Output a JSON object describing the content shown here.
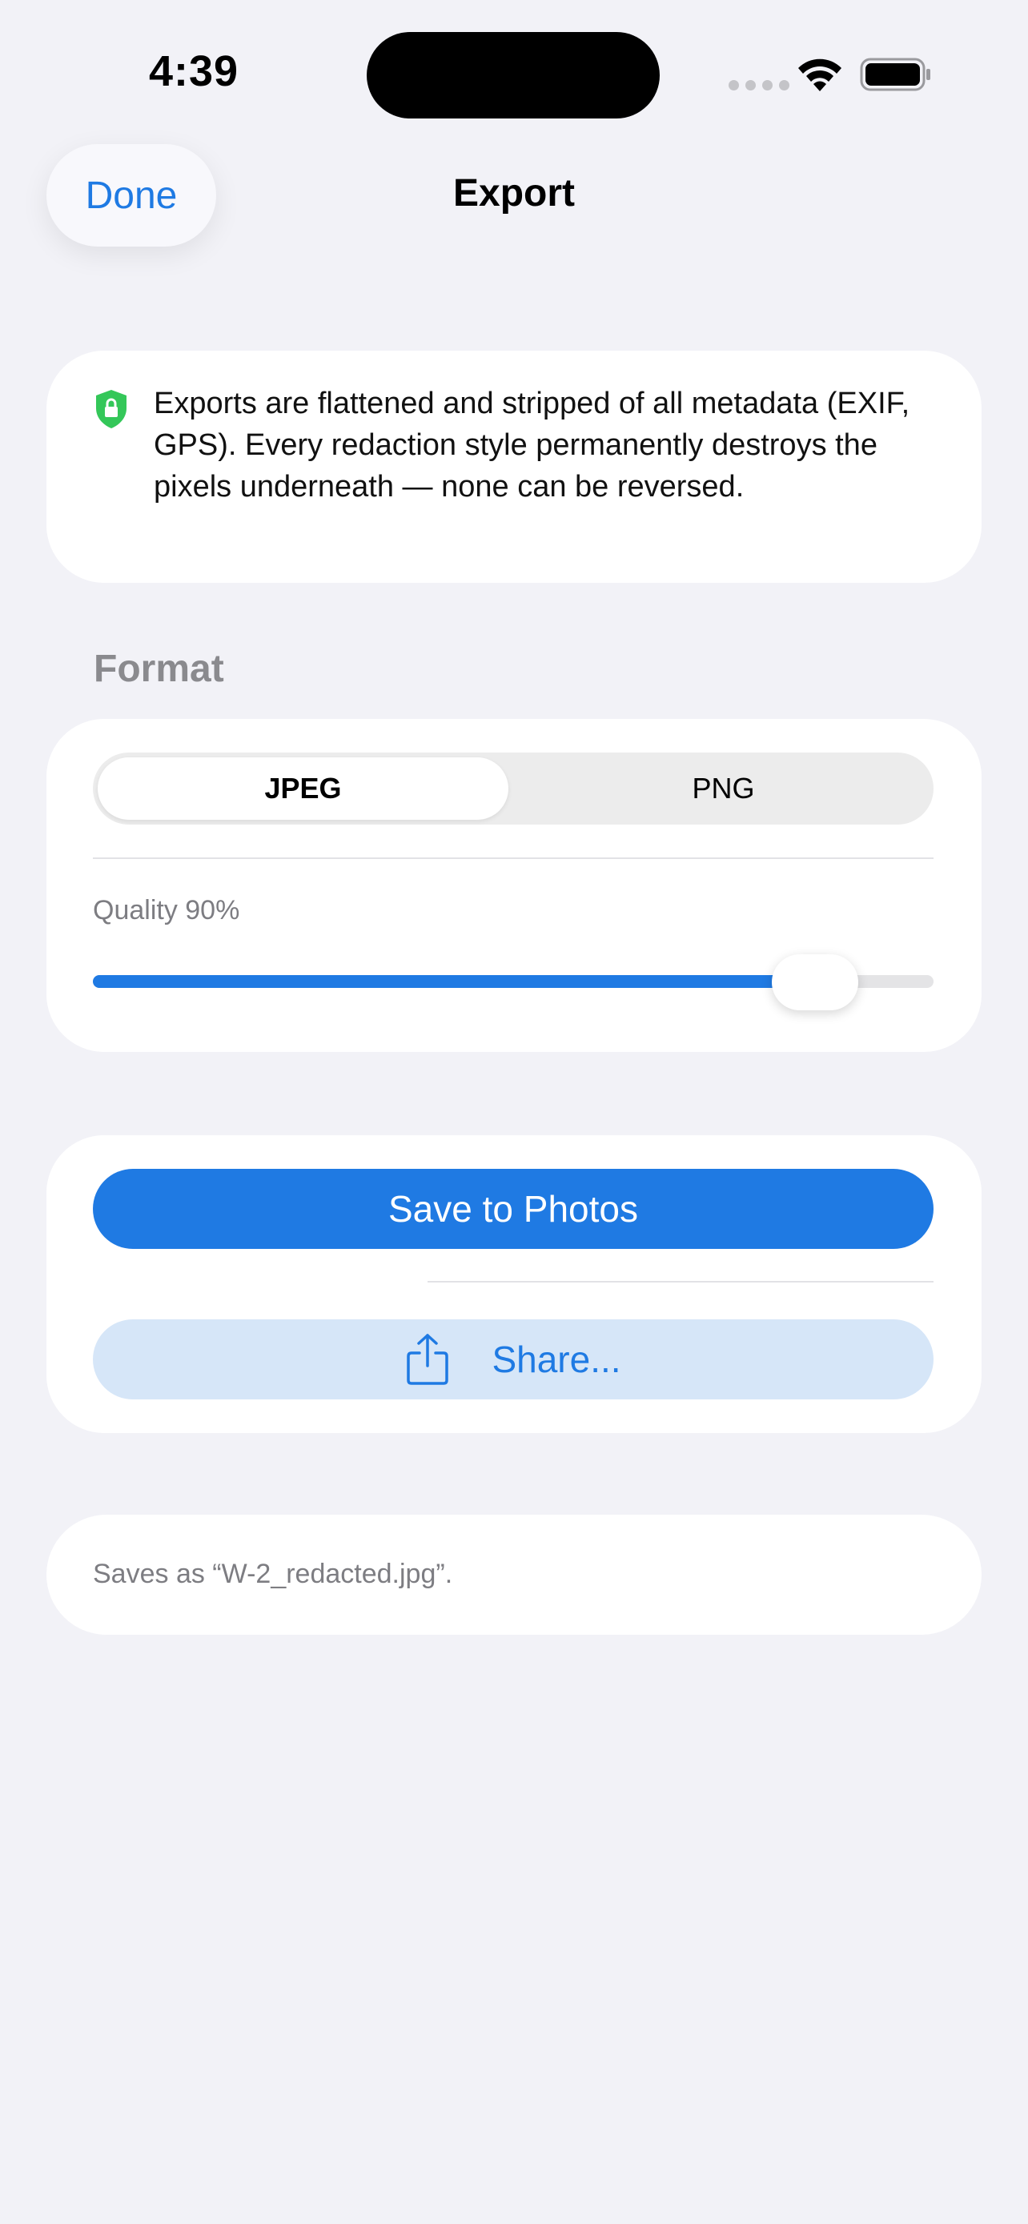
{
  "status_bar": {
    "time": "4:39"
  },
  "nav": {
    "done_label": "Done",
    "title": "Export"
  },
  "info": {
    "icon": "shield-lock-icon",
    "icon_color": "#34c759",
    "text": "Exports are flattened and stripped of all metadata (EXIF, GPS). Every redaction style permanently destroys the pixels underneath — none can be reversed."
  },
  "format": {
    "section_label": "Format",
    "options": [
      "JPEG",
      "PNG"
    ],
    "selected": "JPEG",
    "quality_label": "Quality 90%",
    "quality_value": 0.9
  },
  "actions": {
    "save_label": "Save to Photos",
    "share_label": "Share...",
    "share_icon": "share-icon"
  },
  "footer": {
    "filename_text": "Saves as “W-2_redacted.jpg”."
  },
  "colors": {
    "accent": "#1f7ae3",
    "background": "#f2f2f7",
    "share_background": "#d6e6f8"
  }
}
